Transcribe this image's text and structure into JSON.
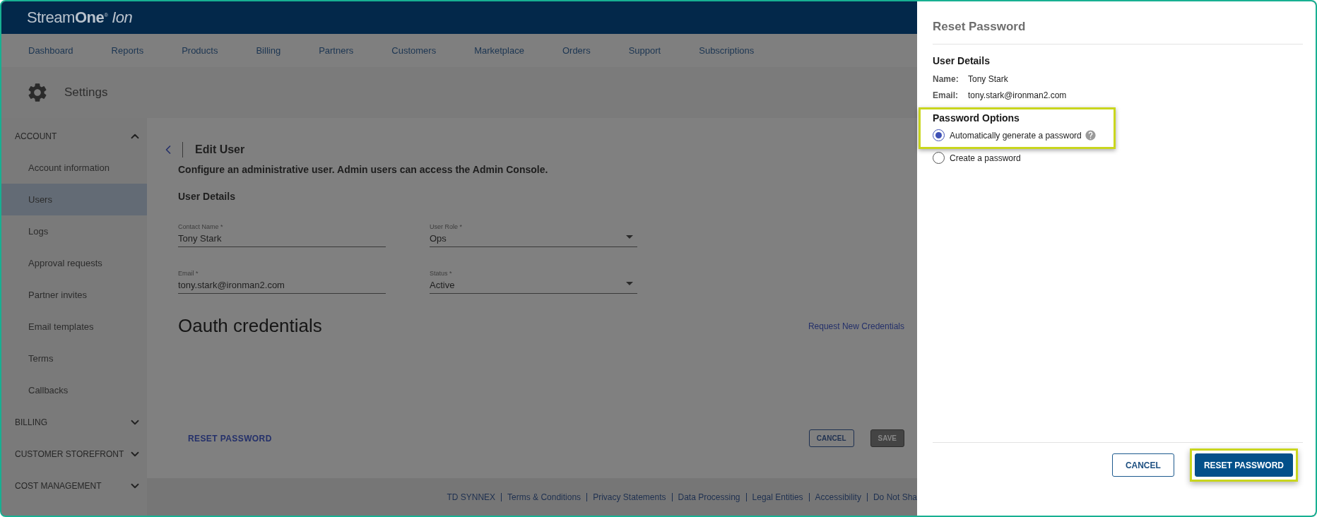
{
  "header": {
    "logo": "Stream**One**$^{®}$ *Ion*"
  },
  "nav": [
    "Dashboard",
    "Reports",
    "Products",
    "Billing",
    "Partners",
    "Customers",
    "Marketplace",
    "Orders",
    "Support",
    "Subscriptions"
  ],
  "page": {
    "title": "Settings"
  },
  "sidebar": [
    {
      "label": "ACCOUNT",
      "expanded": true,
      "items": [
        {
          "label": "Account information",
          "selected": false
        },
        {
          "label": "Users",
          "selected": true
        },
        {
          "label": "Logs",
          "selected": false
        },
        {
          "label": "Approval requests",
          "selected": false
        },
        {
          "label": "Partner invites",
          "selected": false
        },
        {
          "label": "Email templates",
          "selected": false
        },
        {
          "label": "Terms",
          "selected": false
        },
        {
          "label": "Callbacks",
          "selected": false
        }
      ]
    },
    {
      "label": "BILLING",
      "expanded": false
    },
    {
      "label": "CUSTOMER STOREFRONT",
      "expanded": false
    },
    {
      "label": "COST MANAGEMENT",
      "expanded": false
    }
  ],
  "edit_user": {
    "title": "Edit User",
    "description": "Configure an administrative user. Admin users can access the Admin Console.",
    "section": "User Details",
    "fields": [
      {
        "kind": "text",
        "label": "Contact Name *",
        "value": "Tony Stark"
      },
      {
        "kind": "select",
        "label": "User Role *",
        "value": "Ops"
      },
      {
        "kind": "text",
        "label": "Email *",
        "value": "tony.stark@ironman2.com"
      },
      {
        "kind": "select",
        "label": "Status *",
        "value": "Active"
      }
    ],
    "oauth_title": "Oauth credentials",
    "request_link": "Request New Credentials",
    "reset_link": "RESET PASSWORD",
    "buttons": [
      {
        "label": "CANCEL",
        "kind": "outline"
      },
      {
        "label": "SAVE",
        "kind": "primary",
        "disabled": true
      }
    ]
  },
  "footer": {
    "links": [
      "TD SYNNEX",
      "Terms & Conditions",
      "Privacy Statements",
      "Data Processing",
      "Legal Entities",
      "Accessibility",
      "Do Not Sha"
    ]
  },
  "drawer": {
    "title": "Reset Password",
    "section": "User Details",
    "details": [
      {
        "label": "Name:",
        "value": "Tony Stark"
      },
      {
        "label": "Email:",
        "value": "tony.stark@ironman2.com"
      }
    ],
    "options_title": "Password Options",
    "options": [
      {
        "label": "Automatically generate a password",
        "selected": true,
        "help": true,
        "highlighted": true
      },
      {
        "label": "Create a password",
        "selected": false,
        "help": false,
        "highlighted": false
      }
    ],
    "buttons": [
      {
        "label": "CANCEL",
        "kind": "outline",
        "highlighted": false
      },
      {
        "label": "RESET PASSWORD",
        "kind": "primary",
        "highlighted": true
      }
    ]
  }
}
